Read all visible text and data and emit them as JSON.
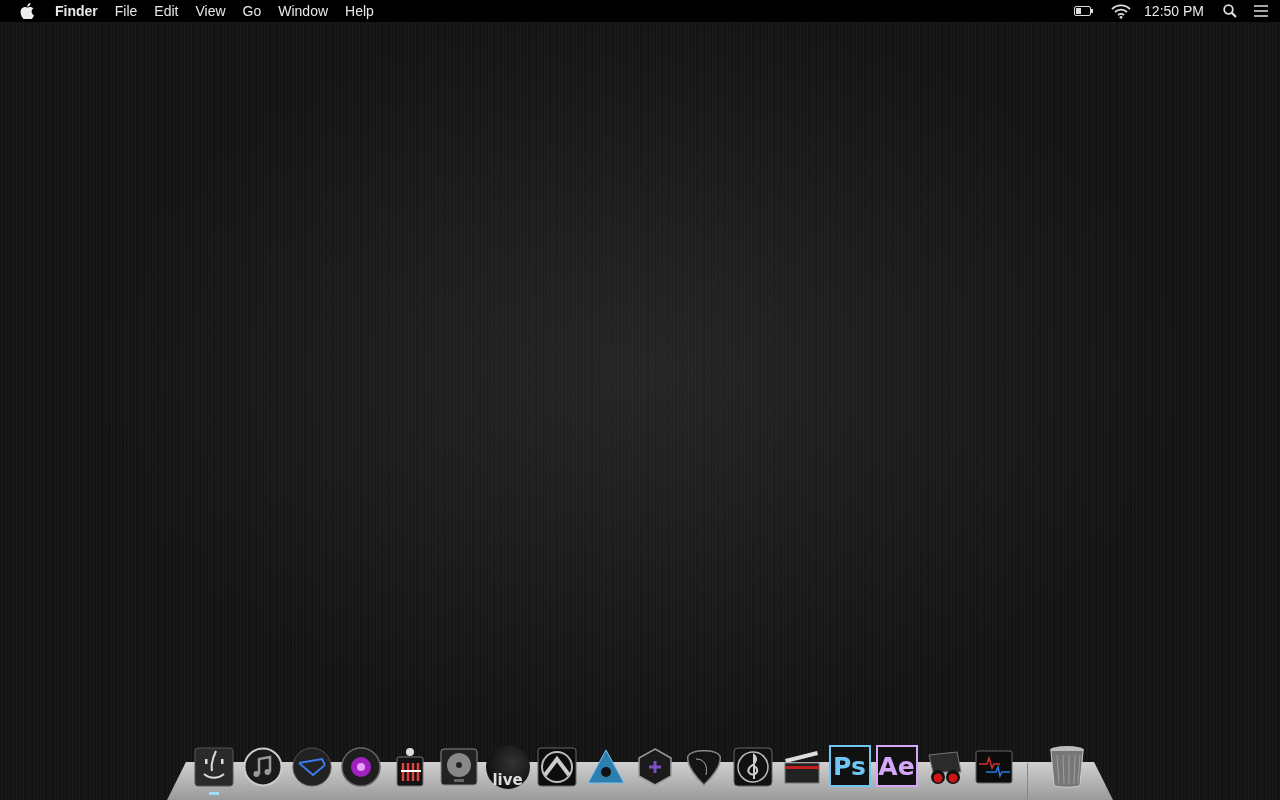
{
  "menu_bar": {
    "app_name": "Finder",
    "menus": [
      "File",
      "Edit",
      "View",
      "Go",
      "Window",
      "Help"
    ],
    "clock": "12:50 PM"
  },
  "dock": {
    "apps": [
      {
        "kind": "finder",
        "running": true
      },
      {
        "kind": "music",
        "running": false
      },
      {
        "kind": "mail",
        "running": false
      },
      {
        "kind": "camera",
        "running": false
      },
      {
        "kind": "mixer",
        "running": false
      },
      {
        "kind": "disc",
        "running": false
      },
      {
        "kind": "live",
        "label": "live",
        "running": false
      },
      {
        "kind": "arch",
        "running": false
      },
      {
        "kind": "triangle",
        "running": false
      },
      {
        "kind": "hexagon",
        "running": false
      },
      {
        "kind": "pick",
        "running": false
      },
      {
        "kind": "clef",
        "running": false
      },
      {
        "kind": "clapper",
        "running": false
      },
      {
        "kind": "tile",
        "label": "Ps",
        "color": "#6fc6f5",
        "running": false
      },
      {
        "kind": "tile",
        "label": "Ae",
        "color": "#d7a7f7",
        "running": false
      },
      {
        "kind": "binoculars",
        "running": false
      },
      {
        "kind": "monitor",
        "running": false
      }
    ],
    "trash": {
      "kind": "trash",
      "running": false
    }
  }
}
